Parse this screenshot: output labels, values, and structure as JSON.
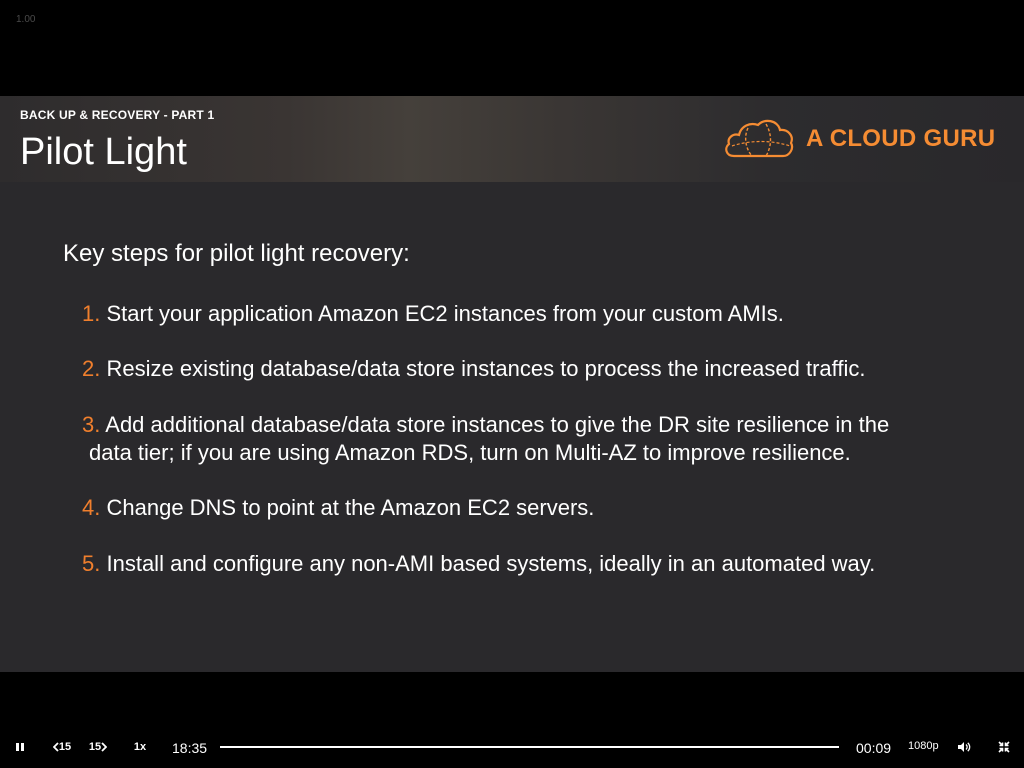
{
  "player": {
    "corner_label": "1.00",
    "slide": {
      "section_label": "BACK UP & RECOVERY - PART 1",
      "title": "Pilot Light",
      "brand": "A CLOUD GURU",
      "intro": "Key steps for pilot light recovery:",
      "steps": [
        {
          "num": "1.",
          "line1": "Start your application Amazon EC2 instances from your custom AMIs.",
          "line2": ""
        },
        {
          "num": "2.",
          "line1": "Resize existing database/data store instances to process the increased traffic.",
          "line2": ""
        },
        {
          "num": "3.",
          "line1": "Add additional database/data store instances to give the DR site resilience in the",
          "line2": "data tier; if you are using Amazon RDS, turn on Multi-AZ to improve resilience."
        },
        {
          "num": "4.",
          "line1": "Change DNS to point at the Amazon EC2 servers.",
          "line2": ""
        },
        {
          "num": "5.",
          "line1": "Install and configure any non-AMI based systems, ideally in an automated way.",
          "line2": ""
        }
      ]
    },
    "controls": {
      "rewind_label": "15",
      "forward_label": "15",
      "speed": "1x",
      "elapsed": "18:35",
      "remaining": "00:09",
      "quality": "1080p",
      "progress_fraction": 0.999,
      "icons": [
        "pause-icon",
        "rewind-15-icon",
        "forward-15-icon",
        "volume-icon",
        "exit-fullscreen-icon"
      ]
    },
    "colors": {
      "accent": "#f07f2d",
      "brand": "#f58c33",
      "slide_bg": "#2a292c",
      "player_bg": "#000000"
    }
  }
}
